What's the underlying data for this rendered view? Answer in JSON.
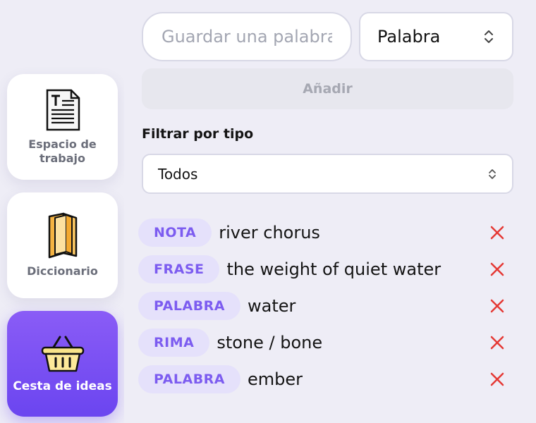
{
  "sidebar": {
    "items": [
      {
        "label": "Espacio de\ntrabajo",
        "icon": "document-icon"
      },
      {
        "label": "Diccionario",
        "icon": "book-icon"
      },
      {
        "label": "Cesta de ideas",
        "icon": "basket-icon",
        "active": true
      }
    ]
  },
  "form": {
    "input_placeholder": "Guardar una palabra",
    "type_selected": "Palabra",
    "add_label": "Añadir"
  },
  "filter": {
    "title": "Filtrar por tipo",
    "selected": "Todos"
  },
  "ideas": [
    {
      "type": "NOTA",
      "text": "river chorus"
    },
    {
      "type": "FRASE",
      "text": "the weight of quiet water"
    },
    {
      "type": "PALABRA",
      "text": "water"
    },
    {
      "type": "RIMA",
      "text": "stone / bone"
    },
    {
      "type": "PALABRA",
      "text": "ember"
    }
  ],
  "colors": {
    "accent": "#7c5cf0",
    "badge_bg": "#e5e1fb",
    "delete": "#e53935",
    "active_nav_from": "#8a5cf6",
    "active_nav_to": "#6b45f0"
  }
}
